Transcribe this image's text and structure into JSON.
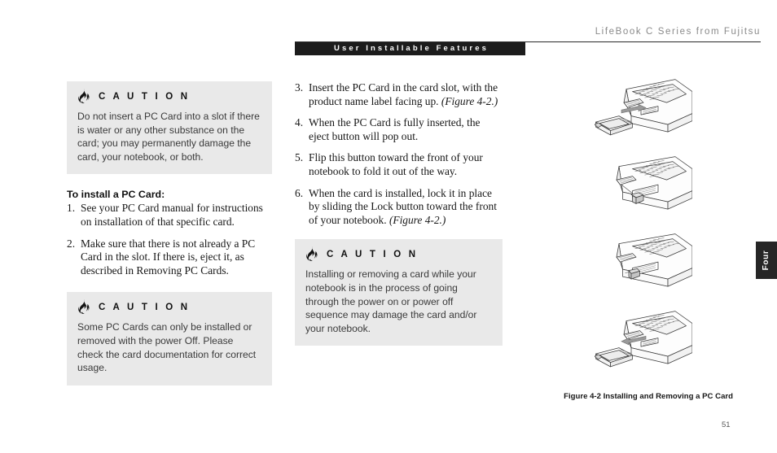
{
  "header": {
    "book_title": "LifeBook C Series from Fujitsu",
    "section_banner": "User Installable Features"
  },
  "side_tab": {
    "label": "Four"
  },
  "page_number": "51",
  "left_column": {
    "caution_1": {
      "icon": "flame-icon",
      "title": "C A U T I O N",
      "body": "Do not insert a PC Card into a slot if there is water or any other substance on the card; you may permanently damage the card, your notebook, or both."
    },
    "heading": "To install a PC Card:",
    "steps": [
      {
        "num": "1.",
        "text": "See your PC Card manual for instructions on installation of that specific card."
      },
      {
        "num": "2.",
        "text": "Make sure that there is not already a PC Card in the slot. If there is, eject it, as described in Removing PC Cards."
      }
    ],
    "caution_2": {
      "icon": "flame-icon",
      "title": "C A U T I O N",
      "body": "Some PC Cards can only be installed or removed with the power Off. Please check the card documentation for correct usage."
    }
  },
  "middle_column": {
    "steps": [
      {
        "num": "3.",
        "text": "Insert the PC Card in the card slot, with the product name label facing up. ",
        "italic": "(Figure 4-2.)"
      },
      {
        "num": "4.",
        "text": "When the PC Card is fully inserted, the eject button will pop out.",
        "italic": ""
      },
      {
        "num": "5.",
        "text": "Flip this button toward the front of your notebook to fold it out of the way.",
        "italic": ""
      },
      {
        "num": "6.",
        "text": "When the card is installed, lock it in place by sliding the Lock button toward the front of your notebook. ",
        "italic": "(Figure 4-2.)"
      }
    ],
    "caution_3": {
      "icon": "flame-icon",
      "title": "C A U T I O N",
      "body": "Installing or removing a card while your notebook is in the process of going through the power on or power off sequence may damage the card and/or your notebook."
    }
  },
  "right_column": {
    "figures": [
      {
        "name": "notebook-card-insert-illustration",
        "alt": "PC Card being inserted into notebook card slot with arrow"
      },
      {
        "name": "notebook-eject-button-illustration",
        "alt": "Close-up of notebook card slot with eject button popped out"
      },
      {
        "name": "notebook-lock-button-illustration",
        "alt": "Close-up of notebook card slot with lock button slid forward"
      },
      {
        "name": "notebook-card-remove-illustration",
        "alt": "PC Card being removed from notebook card slot with arrow"
      }
    ],
    "caption": "Figure 4-2 Installing and Removing a PC Card"
  },
  "colors": {
    "caution_background": "#e9e9e9",
    "banner_background": "#1c1c1c",
    "header_text": "#8a8a8a",
    "tab_background": "#262626"
  }
}
